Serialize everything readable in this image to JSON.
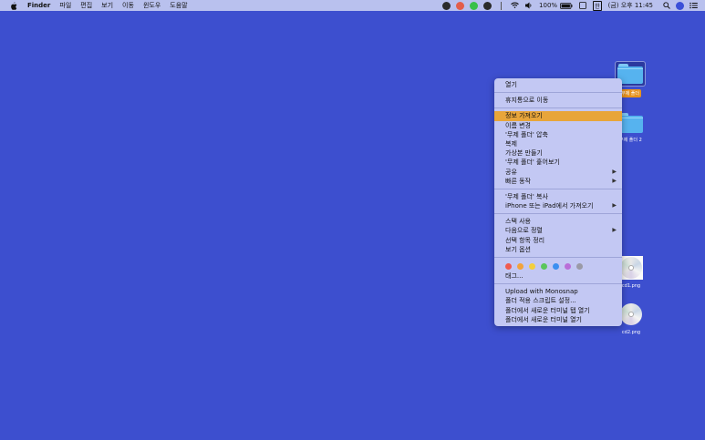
{
  "menubar": {
    "app_name": "Finder",
    "menus": [
      "파일",
      "편집",
      "보기",
      "이동",
      "윈도우",
      "도움말"
    ],
    "battery": "100%",
    "input_source": "한",
    "clock": "(금) 오후 11:45"
  },
  "desktop": {
    "items": [
      {
        "label": "무제 폴더",
        "kind": "folder",
        "selected": true
      },
      {
        "label": "무제 폴더 2",
        "kind": "folder",
        "selected": false
      },
      {
        "label": "cd1.png",
        "kind": "image",
        "selected": false
      },
      {
        "label": "cd2.png",
        "kind": "image",
        "selected": false
      }
    ]
  },
  "context_menu": {
    "open": "열기",
    "move_to_trash": "휴지통으로 이동",
    "get_info": "정보 가져오기",
    "rename": "이름 변경",
    "compress": "'무제 폴더' 압축",
    "duplicate": "복제",
    "make_alias": "가상본 만들기",
    "quick_look": "'무제 폴더' 훑어보기",
    "share": "공유",
    "quick_actions": "빠른 동작",
    "copy": "'무제 폴더' 복사",
    "import_from_iphone": "iPhone 또는 iPad에서 가져오기",
    "use_stacks": "스택 사용",
    "sort_by": "다음으로 정렬",
    "clean_up_selection": "선택 항목 정리",
    "show_view_options": "보기 옵션",
    "tags_label": "태그...",
    "upload_monosnap": "Upload with Monosnap",
    "folder_actions_setup": "폴더 적용 스크립트 설정...",
    "new_terminal_tab": "폴더에서 새로운 터미널 탭 열기",
    "new_terminal": "폴더에서 새로운 터미널 열기"
  },
  "tag_colors": [
    "#f05a4f",
    "#f2a33a",
    "#f3cf3d",
    "#5bc65c",
    "#3b8ff0",
    "#b96ed8",
    "#9a9aa6"
  ],
  "colors": {
    "desktop_bg": "#3d4fcf",
    "highlight": "#e8a53a"
  }
}
